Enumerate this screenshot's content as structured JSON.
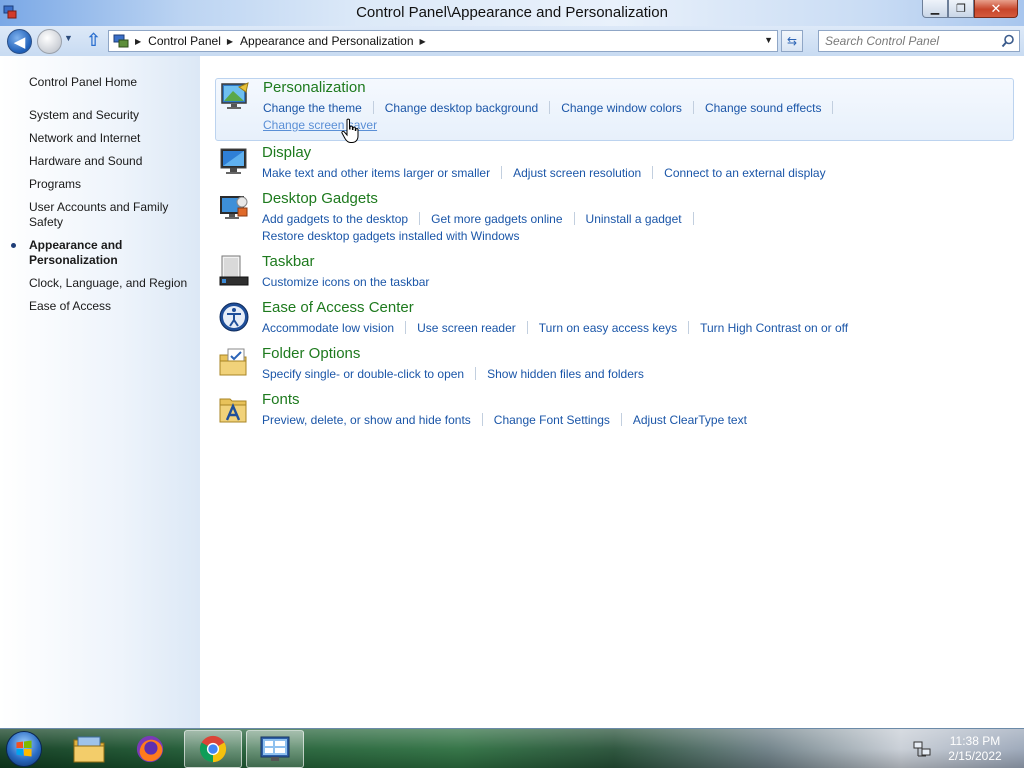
{
  "window": {
    "title": "Control Panel\\Appearance and Personalization",
    "minimize_glyph": "▁",
    "restore_glyph": "❐",
    "close_glyph": "✕"
  },
  "navigation": {
    "back_glyph": "◀",
    "up_glyph": "⇧",
    "breadcrumbs": [
      "Control Panel",
      "Appearance and Personalization"
    ],
    "search_placeholder": "Search Control Panel"
  },
  "sidebar": {
    "home_label": "Control Panel Home",
    "items": [
      {
        "label": "System and Security",
        "active": false
      },
      {
        "label": "Network and Internet",
        "active": false
      },
      {
        "label": "Hardware and Sound",
        "active": false
      },
      {
        "label": "Programs",
        "active": false
      },
      {
        "label": "User Accounts and Family Safety",
        "active": false
      },
      {
        "label": "Appearance and Personalization",
        "active": true
      },
      {
        "label": "Clock, Language, and Region",
        "active": false
      },
      {
        "label": "Ease of Access",
        "active": false
      }
    ]
  },
  "categories": [
    {
      "icon": "personalization-icon",
      "title": "Personalization",
      "highlighted": true,
      "links": [
        "Change the theme",
        "Change desktop background",
        "Change window colors",
        "Change sound effects",
        "Change screen saver"
      ]
    },
    {
      "icon": "display-icon",
      "title": "Display",
      "highlighted": false,
      "links": [
        "Make text and other items larger or smaller",
        "Adjust screen resolution",
        "Connect to an external display"
      ]
    },
    {
      "icon": "desktop-gadgets-icon",
      "title": "Desktop Gadgets",
      "highlighted": false,
      "links": [
        "Add gadgets to the desktop",
        "Get more gadgets online",
        "Uninstall a gadget",
        "Restore desktop gadgets installed with Windows"
      ]
    },
    {
      "icon": "taskbar-icon",
      "title": "Taskbar",
      "highlighted": false,
      "links": [
        "Customize icons on the taskbar"
      ]
    },
    {
      "icon": "ease-of-access-icon",
      "title": "Ease of Access Center",
      "highlighted": false,
      "links": [
        "Accommodate low vision",
        "Use screen reader",
        "Turn on easy access keys",
        "Turn High Contrast on or off"
      ]
    },
    {
      "icon": "folder-options-icon",
      "title": "Folder Options",
      "highlighted": false,
      "links": [
        "Specify single- or double-click to open",
        "Show hidden files and folders"
      ]
    },
    {
      "icon": "fonts-icon",
      "title": "Fonts",
      "highlighted": false,
      "links": [
        "Preview, delete, or show and hide fonts",
        "Change Font Settings",
        "Adjust ClearType text"
      ]
    }
  ],
  "hovered_link": "Change screen saver",
  "taskbar": {
    "time": "11:38 PM",
    "date": "2/15/2022",
    "apps": [
      "file-explorer-icon",
      "firefox-icon",
      "chrome-icon",
      "control-panel-icon"
    ]
  },
  "colors": {
    "category_title": "#1e7a1e",
    "task_link": "#1b56a8",
    "task_link_hover": "#5a8fd6"
  }
}
